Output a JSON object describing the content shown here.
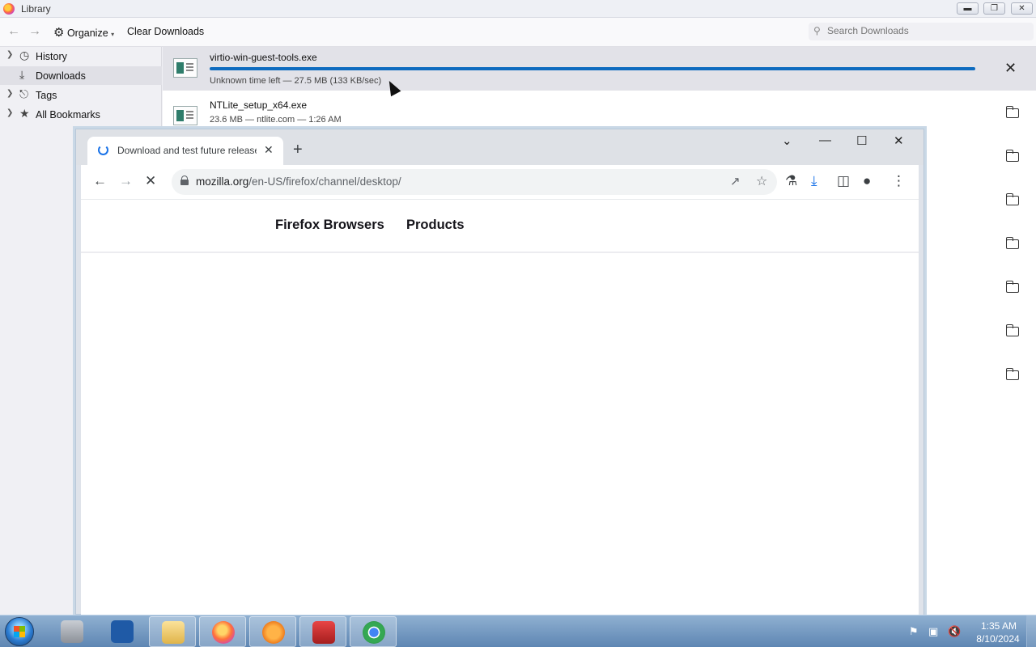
{
  "library": {
    "title": "Library",
    "window_controls": {
      "minimize": "▭",
      "restore": "🗗",
      "close": "✕"
    },
    "toolbar": {
      "back": "←",
      "forward": "→",
      "organize_label": "Organize",
      "clear_label": "Clear Downloads",
      "search_placeholder": "Search Downloads"
    },
    "sidebar": {
      "items": [
        {
          "label": "History",
          "icon": "clock-icon"
        },
        {
          "label": "Downloads",
          "icon": "download-icon",
          "selected": true
        },
        {
          "label": "Tags",
          "icon": "tag-icon"
        },
        {
          "label": "All Bookmarks",
          "icon": "star-icon"
        }
      ]
    },
    "downloads": [
      {
        "name": "virtio-win-guest-tools.exe",
        "status": "Unknown time left — 27.5 MB (133 KB/sec)",
        "active": true,
        "progress": 1.0
      },
      {
        "name": "NTLite_setup_x64.exe",
        "status": "23.6 MB — ntlite.com — 1:26 AM",
        "active": false
      }
    ]
  },
  "chrome": {
    "tab_title": "Download and test future releases",
    "url_host": "mozilla.org",
    "url_path": "/en-US/firefox/channel/desktop/",
    "page": {
      "nav": [
        "Firefox Browsers",
        "Products"
      ]
    }
  },
  "taskbar": {
    "apps": [
      "server-manager",
      "powershell",
      "file-explorer",
      "firefox",
      "vlc",
      "toolbox",
      "chrome"
    ],
    "time": "1:35 AM",
    "date": "8/10/2024"
  },
  "colors": {
    "progress": "#0e6bbf",
    "chrome_accent": "#1a73e8",
    "taskbar": "#6a90bc"
  }
}
